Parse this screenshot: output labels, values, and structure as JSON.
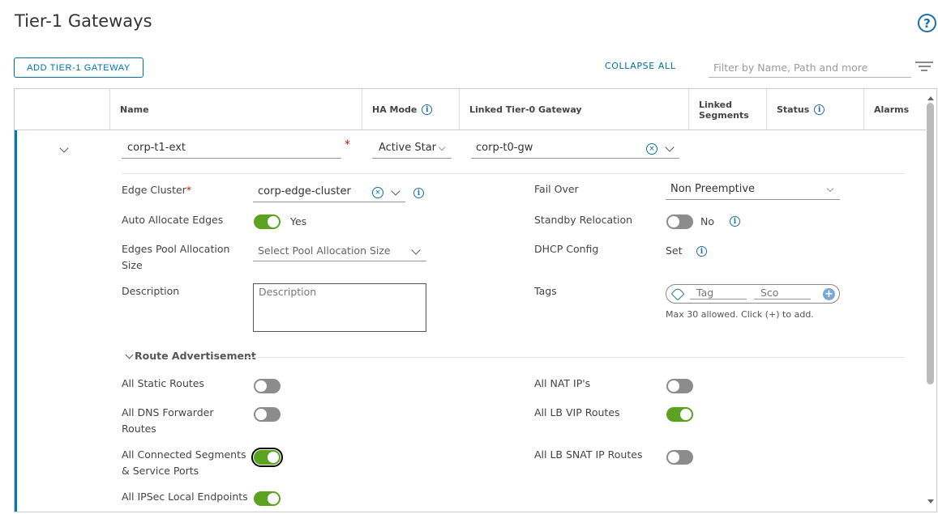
{
  "page": {
    "title": "Tier-1 Gateways"
  },
  "toolbar": {
    "add_label": "ADD TIER-1 GATEWAY",
    "collapse_label": "COLLAPSE ALL",
    "filter_placeholder": "Filter by Name, Path and more"
  },
  "grid": {
    "columns": {
      "name": "Name",
      "ha_mode": "HA Mode",
      "linked_t0": "Linked Tier-0 Gateway",
      "linked_segments_1": "Linked",
      "linked_segments_2": "Segments",
      "status": "Status",
      "alarms": "Alarms"
    }
  },
  "row": {
    "name": "corp-t1-ext",
    "ha_mode": "Active Star",
    "linked_t0": "corp-t0-gw",
    "edge_cluster_label": "Edge Cluster",
    "edge_cluster": "corp-edge-cluster",
    "fail_over_label": "Fail Over",
    "fail_over": "Non Preemptive",
    "auto_allocate_label": "Auto Allocate Edges",
    "auto_allocate_value": "Yes",
    "standby_label": "Standby Relocation",
    "standby_value": "No",
    "pool_label_1": "Edges Pool Allocation",
    "pool_label_2": "Size",
    "pool_placeholder": "Select Pool Allocation Size",
    "dhcp_label": "DHCP Config",
    "dhcp_value": "Set",
    "description_label": "Description",
    "description_placeholder": "Description",
    "tags_label": "Tags",
    "tag_placeholder": "Tag",
    "scope_placeholder": "Sco",
    "tags_hint": "Max 30 allowed. Click (+) to add."
  },
  "route_adv": {
    "section_label": "Route Advertisement",
    "static_routes": "All Static Routes",
    "dns_1": "All DNS Forwarder",
    "dns_2": "Routes",
    "connected_1": "All Connected Segments",
    "connected_2": "& Service Ports",
    "ipsec": "All IPSec Local Endpoints",
    "nat": "All NAT IP's",
    "lb_vip": "All LB VIP Routes",
    "lb_snat": "All LB SNAT IP Routes"
  }
}
